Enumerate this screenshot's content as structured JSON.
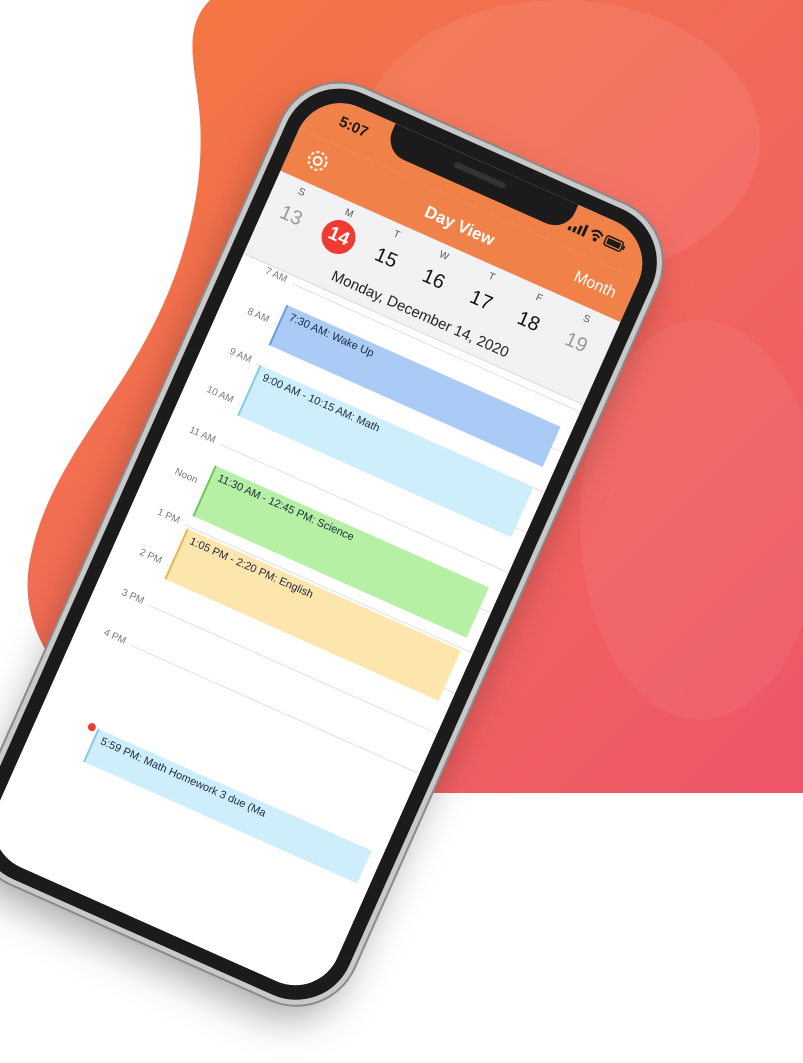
{
  "status": {
    "time": "5:07"
  },
  "nav": {
    "title": "Day View",
    "month_label": "Month"
  },
  "week": {
    "days": [
      {
        "letter": "S",
        "num": "13"
      },
      {
        "letter": "M",
        "num": "14"
      },
      {
        "letter": "T",
        "num": "15"
      },
      {
        "letter": "W",
        "num": "16"
      },
      {
        "letter": "T",
        "num": "17"
      },
      {
        "letter": "F",
        "num": "18"
      },
      {
        "letter": "S",
        "num": "19"
      }
    ],
    "selected_date": "Monday, December 14, 2020"
  },
  "hours": [
    "7 AM",
    "8 AM",
    "9 AM",
    "10 AM",
    "11 AM",
    "Noon",
    "1 PM",
    "2 PM",
    "3 PM",
    "4 PM"
  ],
  "events": [
    {
      "label": "7:30 AM: Wake Up"
    },
    {
      "label": "9:00 AM - 10:15 AM: Math"
    },
    {
      "label": "11:30 AM - 12:45 PM: Science"
    },
    {
      "label": "1:05 PM - 2:20 PM: English"
    },
    {
      "label": "5:59 PM: Math Homework 3 due (Ma"
    }
  ],
  "colors": {
    "accent": "#f08148",
    "today": "#ef3b31",
    "wake": "#a9cbf6",
    "math": "#cfeefb",
    "science": "#b5f0a5",
    "english": "#fde6ad"
  },
  "icons": {
    "settings": "gear-icon",
    "wifi": "wifi-icon",
    "battery": "battery-icon"
  }
}
